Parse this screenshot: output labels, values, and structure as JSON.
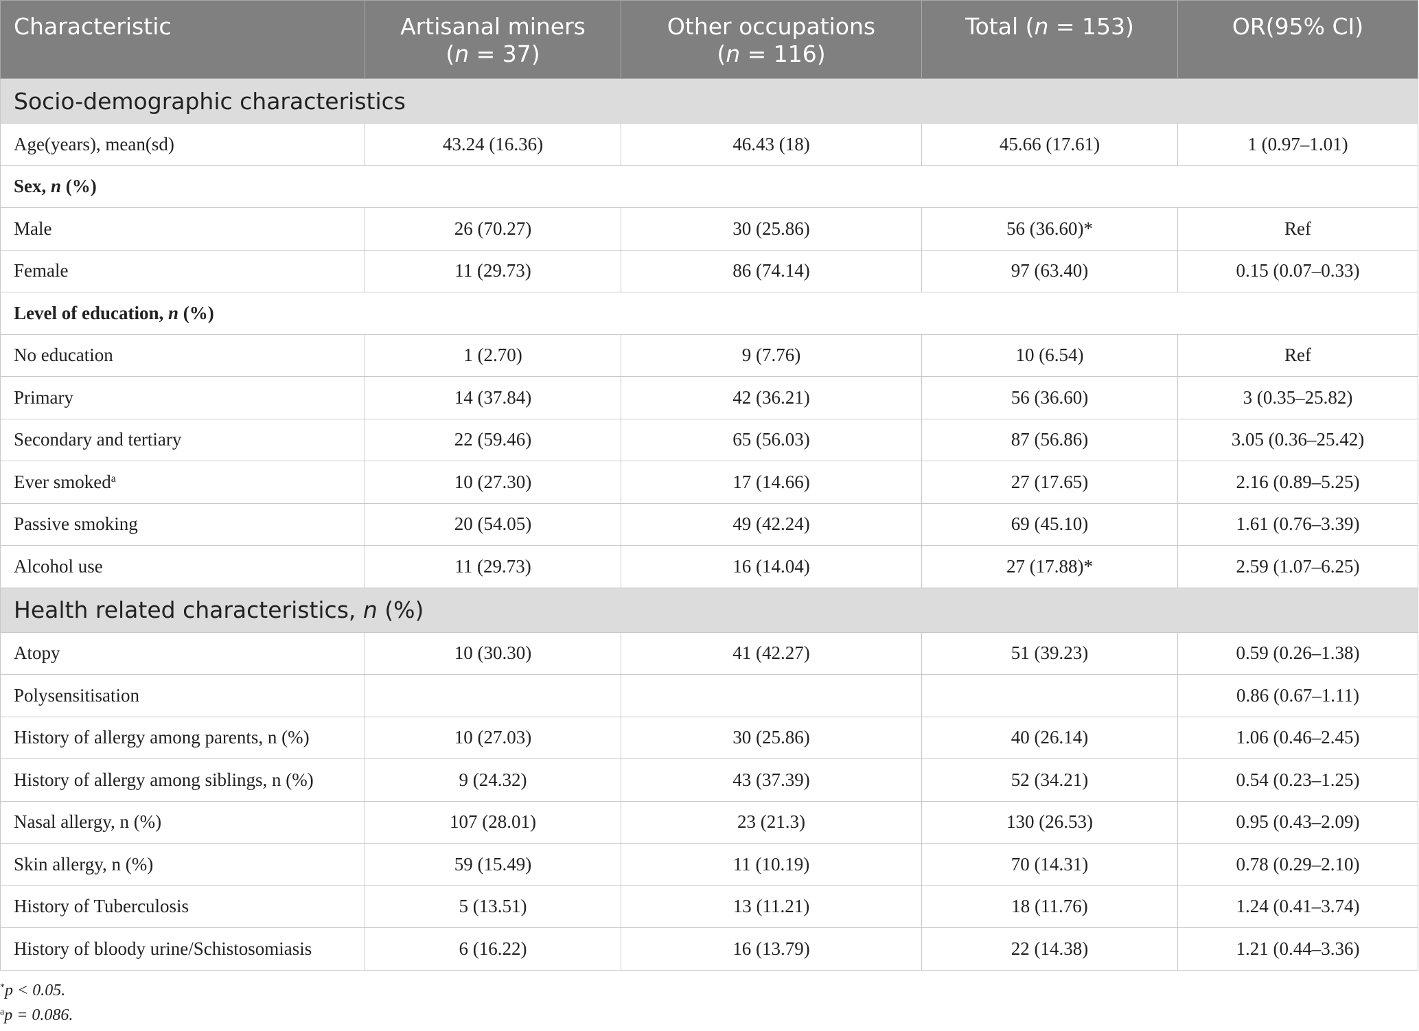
{
  "header": {
    "characteristic": "Characteristic",
    "miners": {
      "line1": "Artisanal miners",
      "n_label": "n",
      "n_value": " = 37)"
    },
    "other": {
      "line1": "Other occupations",
      "n_label": "n",
      "n_value": " = 116)"
    },
    "total": {
      "prefix": "Total (",
      "n_label": "n",
      "suffix": " = 153)"
    },
    "or": "OR(95% CI)"
  },
  "sections": {
    "socio": "Socio-demographic characteristics",
    "health": {
      "prefix": "Health related characteristics, ",
      "n_label": "n",
      "suffix": " (%)"
    }
  },
  "subheads": {
    "sex": {
      "text": "Sex, ",
      "n_label": "n",
      "suffix": " (%)"
    },
    "education": {
      "text": "Level of education, ",
      "n_label": "n",
      "suffix": " (%)"
    }
  },
  "rows": {
    "age": {
      "label": "Age(years), mean(sd)",
      "miners": "43.24 (16.36)",
      "other": "46.43 (18)",
      "total": "45.66 (17.61)",
      "or": "1 (0.97–1.01)"
    },
    "male": {
      "label": "Male",
      "miners": "26 (70.27)",
      "other": "30 (25.86)",
      "total": "56 (36.60)*",
      "or": "Ref"
    },
    "female": {
      "label": "Female",
      "miners": "11 (29.73)",
      "other": "86 (74.14)",
      "total": "97 (63.40)",
      "or": "0.15 (0.07–0.33)"
    },
    "no_education": {
      "label": "No education",
      "miners": "1 (2.70)",
      "other": "9 (7.76)",
      "total": "10 (6.54)",
      "or": "Ref"
    },
    "primary": {
      "label": "Primary",
      "miners": "14 (37.84)",
      "other": "42 (36.21)",
      "total": "56 (36.60)",
      "or": "3 (0.35–25.82)"
    },
    "secondary": {
      "label": "Secondary and tertiary",
      "miners": "22 (59.46)",
      "other": "65 (56.03)",
      "total": "87 (56.86)",
      "or": "3.05 (0.36–25.42)"
    },
    "ever_smoked": {
      "label": "Ever smoked",
      "sup": "a",
      "miners": "10 (27.30)",
      "other": "17 (14.66)",
      "total": "27 (17.65)",
      "or": "2.16 (0.89–5.25)"
    },
    "passive": {
      "label": "Passive smoking",
      "miners": "20 (54.05)",
      "other": "49 (42.24)",
      "total": "69 (45.10)",
      "or": "1.61 (0.76–3.39)"
    },
    "alcohol": {
      "label": "Alcohol use",
      "miners": "11 (29.73)",
      "other": "16 (14.04)",
      "total": "27 (17.88)*",
      "or": "2.59 (1.07–6.25)"
    },
    "atopy": {
      "label": "Atopy",
      "miners": "10 (30.30)",
      "other": "41 (42.27)",
      "total": "51 (39.23)",
      "or": "0.59 (0.26–1.38)"
    },
    "polysens": {
      "label": "Polysensitisation",
      "miners": "",
      "other": "",
      "total": "",
      "or": "0.86 (0.67–1.11)"
    },
    "allergy_parents": {
      "label": "History of allergy among parents, n (%)",
      "miners": "10 (27.03)",
      "other": "30 (25.86)",
      "total": "40 (26.14)",
      "or": "1.06 (0.46–2.45)"
    },
    "allergy_siblings": {
      "label": "History of allergy among siblings, n (%)",
      "miners": "9 (24.32)",
      "other": "43 (37.39)",
      "total": "52 (34.21)",
      "or": "0.54 (0.23–1.25)"
    },
    "nasal": {
      "label": "Nasal allergy, n (%)",
      "miners": "107 (28.01)",
      "other": "23 (21.3)",
      "total": "130 (26.53)",
      "or": "0.95 (0.43–2.09)"
    },
    "skin": {
      "label": "Skin allergy, n (%)",
      "miners": "59 (15.49)",
      "other": "11 (10.19)",
      "total": "70 (14.31)",
      "or": "0.78 (0.29–2.10)"
    },
    "tb": {
      "label": "History of Tuberculosis",
      "miners": "5 (13.51)",
      "other": "13 (11.21)",
      "total": "18 (11.76)",
      "or": "1.24 (0.41–3.74)"
    },
    "schisto": {
      "label": "History of bloody urine/Schistosomiasis",
      "miners": "6 (16.22)",
      "other": "16 (13.79)",
      "total": "22 (14.38)",
      "or": "1.21 (0.44–3.36)"
    }
  },
  "footnotes": {
    "star": {
      "mark": "*",
      "text": "p < 0.05."
    },
    "a": {
      "mark": "a",
      "text": "p = 0.086."
    }
  }
}
